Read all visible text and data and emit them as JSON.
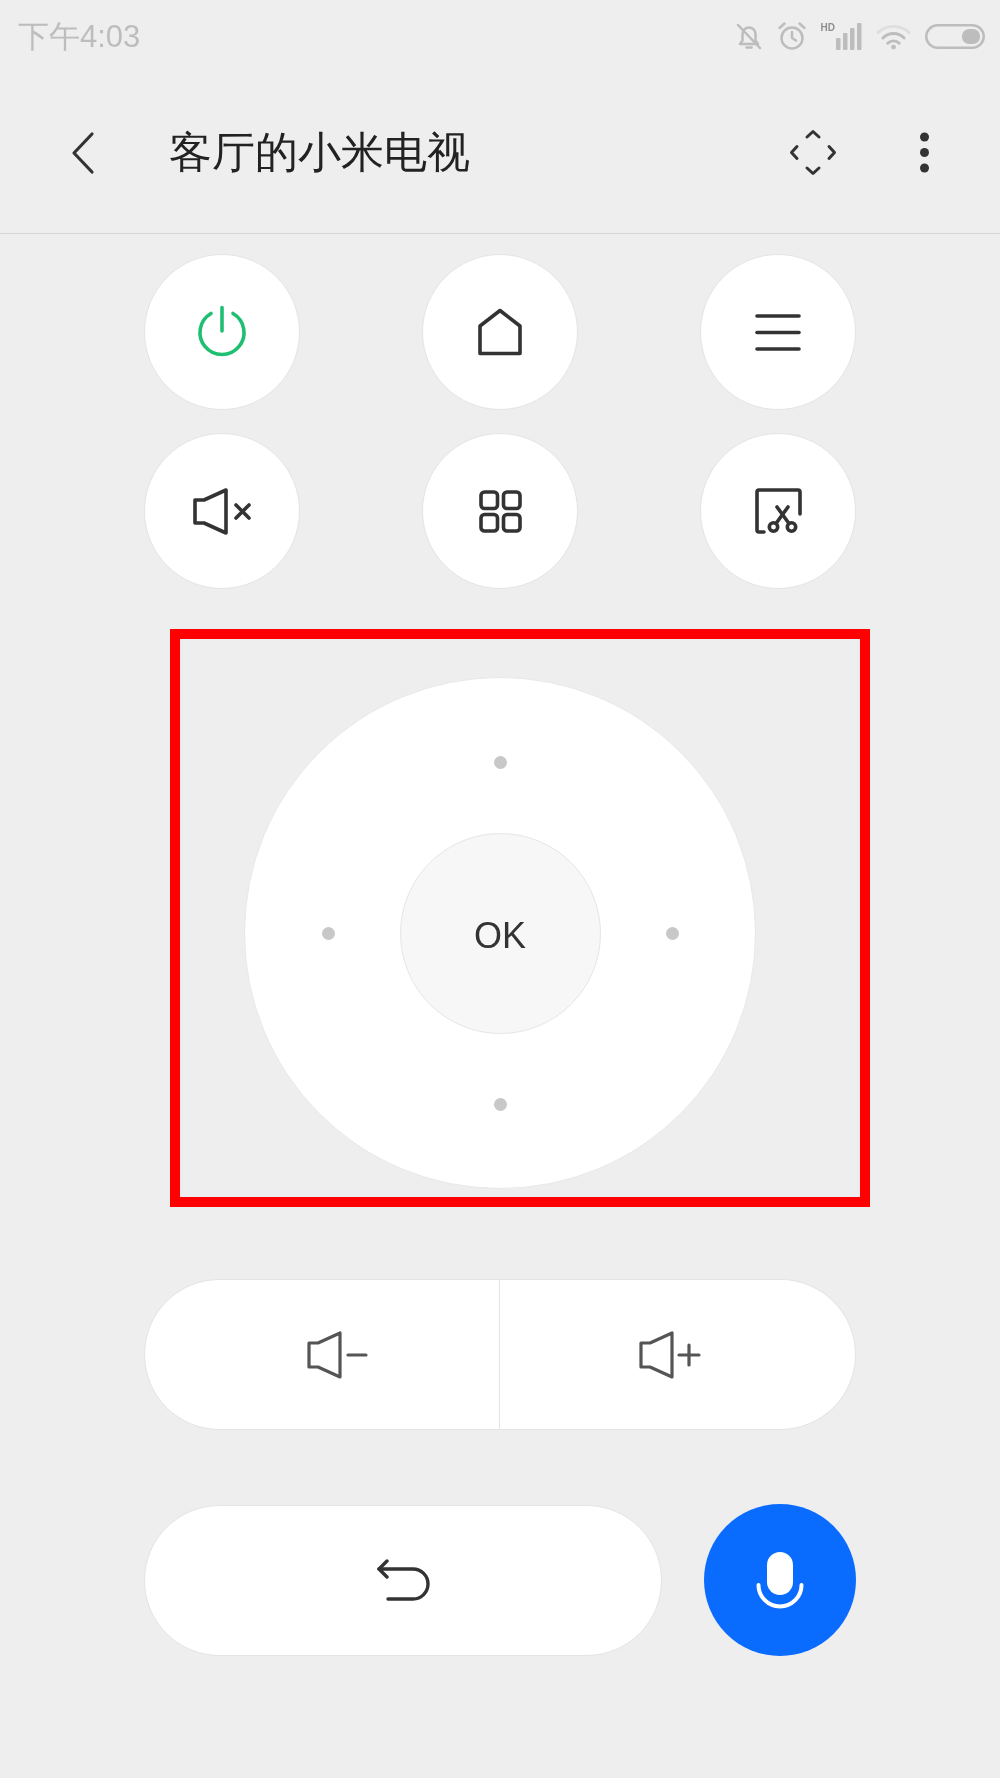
{
  "status_bar": {
    "time": "下午4:03",
    "network_label": "HD"
  },
  "header": {
    "title": "客厅的小米电视"
  },
  "power_key": {
    "on": true
  },
  "dpad": {
    "ok_label": "OK",
    "highlighted": true
  }
}
